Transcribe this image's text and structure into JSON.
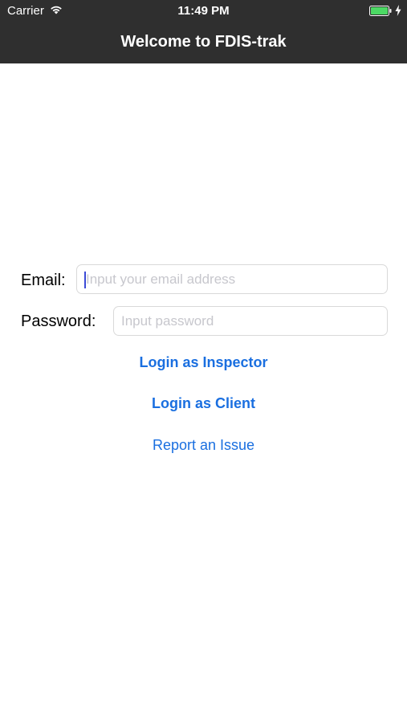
{
  "status_bar": {
    "carrier": "Carrier",
    "time": "11:49 PM",
    "battery_color": "#4cd964"
  },
  "nav": {
    "title": "Welcome to FDIS-trak"
  },
  "form": {
    "email_label": "Email:",
    "email_placeholder": "Input your email address",
    "email_value": "",
    "password_label": "Password:",
    "password_placeholder": "Input password",
    "password_value": ""
  },
  "actions": {
    "login_inspector": "Login as Inspector",
    "login_client": "Login as Client",
    "report_issue": "Report an Issue"
  },
  "colors": {
    "nav_background": "#2f2f2f",
    "link": "#1a6fe0",
    "caret": "#3c4bd6"
  }
}
